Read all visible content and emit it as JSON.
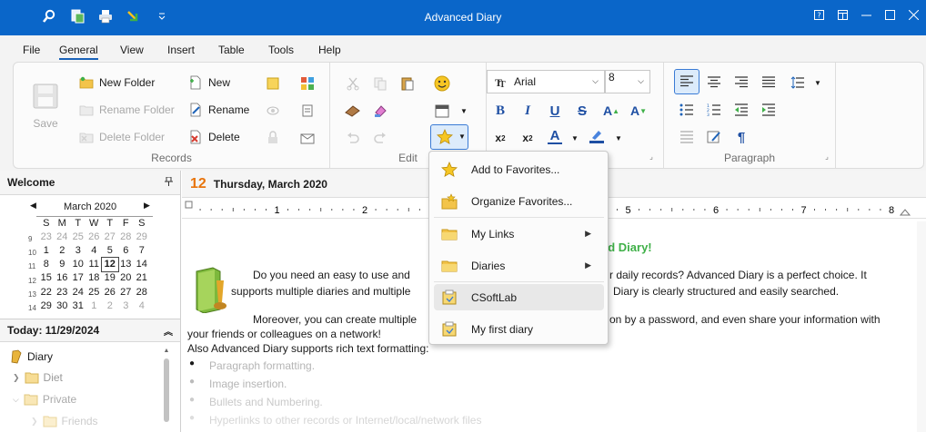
{
  "window": {
    "title": "Advanced Diary"
  },
  "quick_access": [
    {
      "icon": "search-icon"
    },
    {
      "icon": "calculator-icon"
    },
    {
      "icon": "print-icon"
    },
    {
      "icon": "import-icon"
    },
    {
      "icon": "customize-qat-icon"
    }
  ],
  "window_controls": [
    "help-icon",
    "restore-ribbon-icon",
    "minimize-icon",
    "maximize-icon",
    "close-icon"
  ],
  "menu": {
    "items": [
      "File",
      "General",
      "View",
      "Insert",
      "Table",
      "Tools",
      "Help"
    ],
    "active": "General"
  },
  "ribbon": {
    "records": {
      "label": "Records",
      "save": "Save",
      "new_folder": "New Folder",
      "rename_folder": "Rename Folder",
      "delete_folder": "Delete Folder",
      "new": "New",
      "rename": "Rename",
      "delete": "Delete"
    },
    "edit": {
      "label": "Edit"
    },
    "font": {
      "name": "Arial",
      "size": "8"
    },
    "paragraph": {
      "label": "Paragraph"
    }
  },
  "welcome": {
    "title": "Welcome",
    "calendar": {
      "month": "March 2020",
      "weekdays": [
        "S",
        "M",
        "T",
        "W",
        "T",
        "F",
        "S"
      ],
      "weeks": [
        "9",
        "10",
        "11",
        "12",
        "13",
        "14"
      ],
      "rows": [
        [
          "23",
          "24",
          "25",
          "26",
          "27",
          "28",
          "29"
        ],
        [
          "1",
          "2",
          "3",
          "4",
          "5",
          "6",
          "7"
        ],
        [
          "8",
          "9",
          "10",
          "11",
          "12",
          "13",
          "14"
        ],
        [
          "15",
          "16",
          "17",
          "18",
          "19",
          "20",
          "21"
        ],
        [
          "22",
          "23",
          "24",
          "25",
          "26",
          "27",
          "28"
        ],
        [
          "29",
          "30",
          "31",
          "1",
          "2",
          "3",
          "4"
        ]
      ]
    }
  },
  "today": {
    "label": "Today: 11/29/2024"
  },
  "tree": {
    "root": "Diary",
    "items": [
      "Diet",
      "Private",
      "Friends"
    ]
  },
  "entry": {
    "day": "12",
    "date": "Thursday, March 2020"
  },
  "ruler": {
    "marks": [
      "1",
      "2",
      "3",
      "4",
      "5",
      "6",
      "7",
      "8"
    ]
  },
  "document": {
    "heading_fragment": "ed Diary!",
    "p1_a": "Do you need an easy to use and",
    "p1_b": "r daily records? Advanced Diary is a perfect choice. It",
    "p1_c": "supports multiple diaries and multiple",
    "p1_d": "Diary is clearly structured and easily searched.",
    "p2_a": "Moreover, you can create multiple",
    "p2_b": "on by a password, and even share your information with",
    "p2_c": "your friends or colleagues on a network!",
    "p3": "Also Advanced Diary supports rich text formatting:",
    "bullets": [
      "Paragraph formatting.",
      "Image insertion.",
      "Bullets and Numbering.",
      "Hyperlinks to other records or Internet/local/network files"
    ]
  },
  "favorites_menu": {
    "items": [
      {
        "label": "Add to Favorites...",
        "icon": "star-icon",
        "submenu": false
      },
      {
        "label": "Organize Favorites...",
        "icon": "star-folder-icon",
        "submenu": false
      },
      {
        "label": "My Links",
        "icon": "folder-icon",
        "submenu": true
      },
      {
        "label": "Diaries",
        "icon": "folder-icon",
        "submenu": true
      },
      {
        "label": "CSoftLab",
        "icon": "diary-link-icon",
        "submenu": false
      },
      {
        "label": "My first diary",
        "icon": "diary-link-icon",
        "submenu": false
      }
    ]
  }
}
